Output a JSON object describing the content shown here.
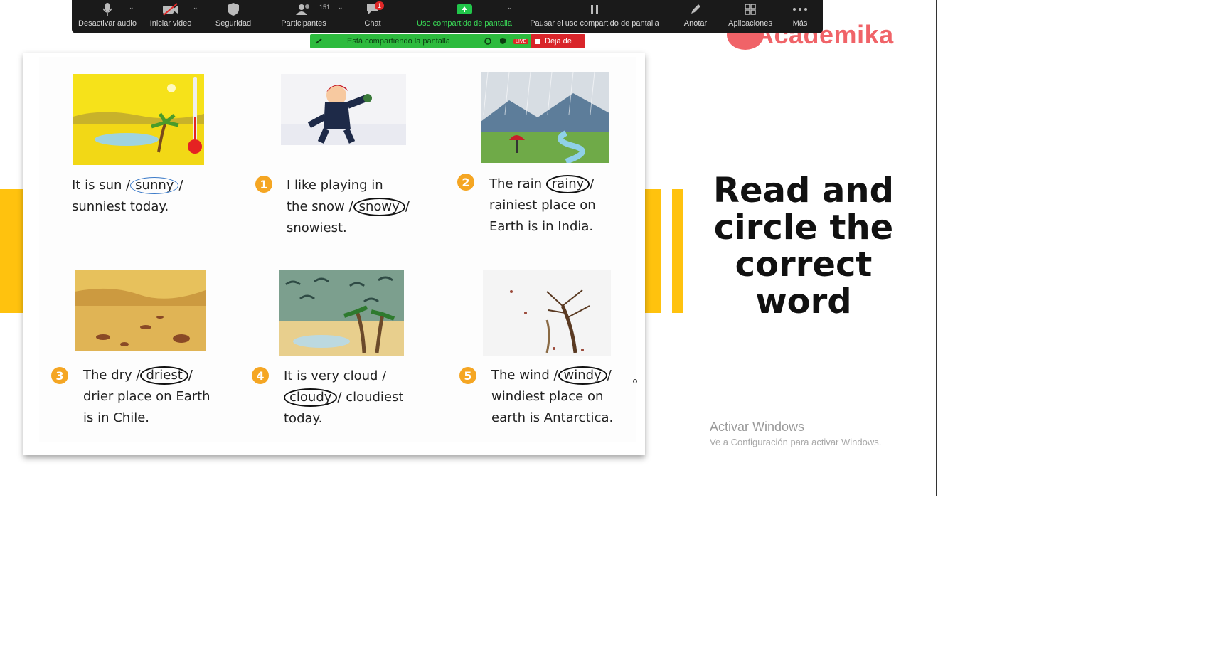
{
  "toolbar": {
    "items": [
      {
        "label": "Desactivar audio",
        "icon": "microphone-icon"
      },
      {
        "label": "Iniciar video",
        "icon": "video-off-icon"
      },
      {
        "label": "Seguridad",
        "icon": "shield-icon"
      },
      {
        "label": "Participantes",
        "icon": "participants-icon",
        "count": "151"
      },
      {
        "label": "Chat",
        "icon": "chat-icon",
        "badge": "1"
      },
      {
        "label": "Uso compartido de pantalla",
        "icon": "share-screen-icon"
      },
      {
        "label": "Pausar el uso compartido de pantalla",
        "icon": "pause-icon"
      },
      {
        "label": "Anotar",
        "icon": "pencil-icon"
      },
      {
        "label": "Aplicaciones",
        "icon": "apps-icon"
      },
      {
        "label": "Más",
        "icon": "more-icon"
      }
    ]
  },
  "share_banner": {
    "text": "Está compartiendo la pantalla",
    "live": "LIVE",
    "stop_label": "Deja de"
  },
  "logo": {
    "text": "Academika"
  },
  "slide": {
    "title_lines": [
      "Read and",
      "circle the",
      "correct",
      "word"
    ]
  },
  "worksheet": {
    "exercises": [
      {
        "number": "",
        "lines": [
          "It is sun /",
          "sunny",
          "/",
          "sunniest today."
        ]
      },
      {
        "number": "1",
        "lines": [
          "I like playing in",
          "the snow /",
          "snowy",
          "/",
          "snowiest."
        ]
      },
      {
        "number": "2",
        "lines": [
          "The rain",
          "rainy",
          "/",
          "rainiest place on",
          "Earth is in India."
        ]
      },
      {
        "number": "3",
        "lines": [
          "The dry /",
          "driest",
          "/",
          "drier place on Earth",
          "is in Chile."
        ]
      },
      {
        "number": "4",
        "lines": [
          "It is very cloud /",
          "cloudy",
          "/ cloudiest",
          "today."
        ]
      },
      {
        "number": "5",
        "lines": [
          "The wind /",
          "windy",
          "/",
          "windiest place on",
          "earth is Antarctica."
        ]
      }
    ]
  },
  "watermark": {
    "line1": "Activar Windows",
    "line2": "Ve a Configuración para activar Windows."
  },
  "colors": {
    "accent_yellow": "#ffc20e",
    "share_green": "#2dbb3e",
    "stop_red": "#d9252a",
    "logo_coral": "#f06368",
    "number_orange": "#f5a623"
  }
}
